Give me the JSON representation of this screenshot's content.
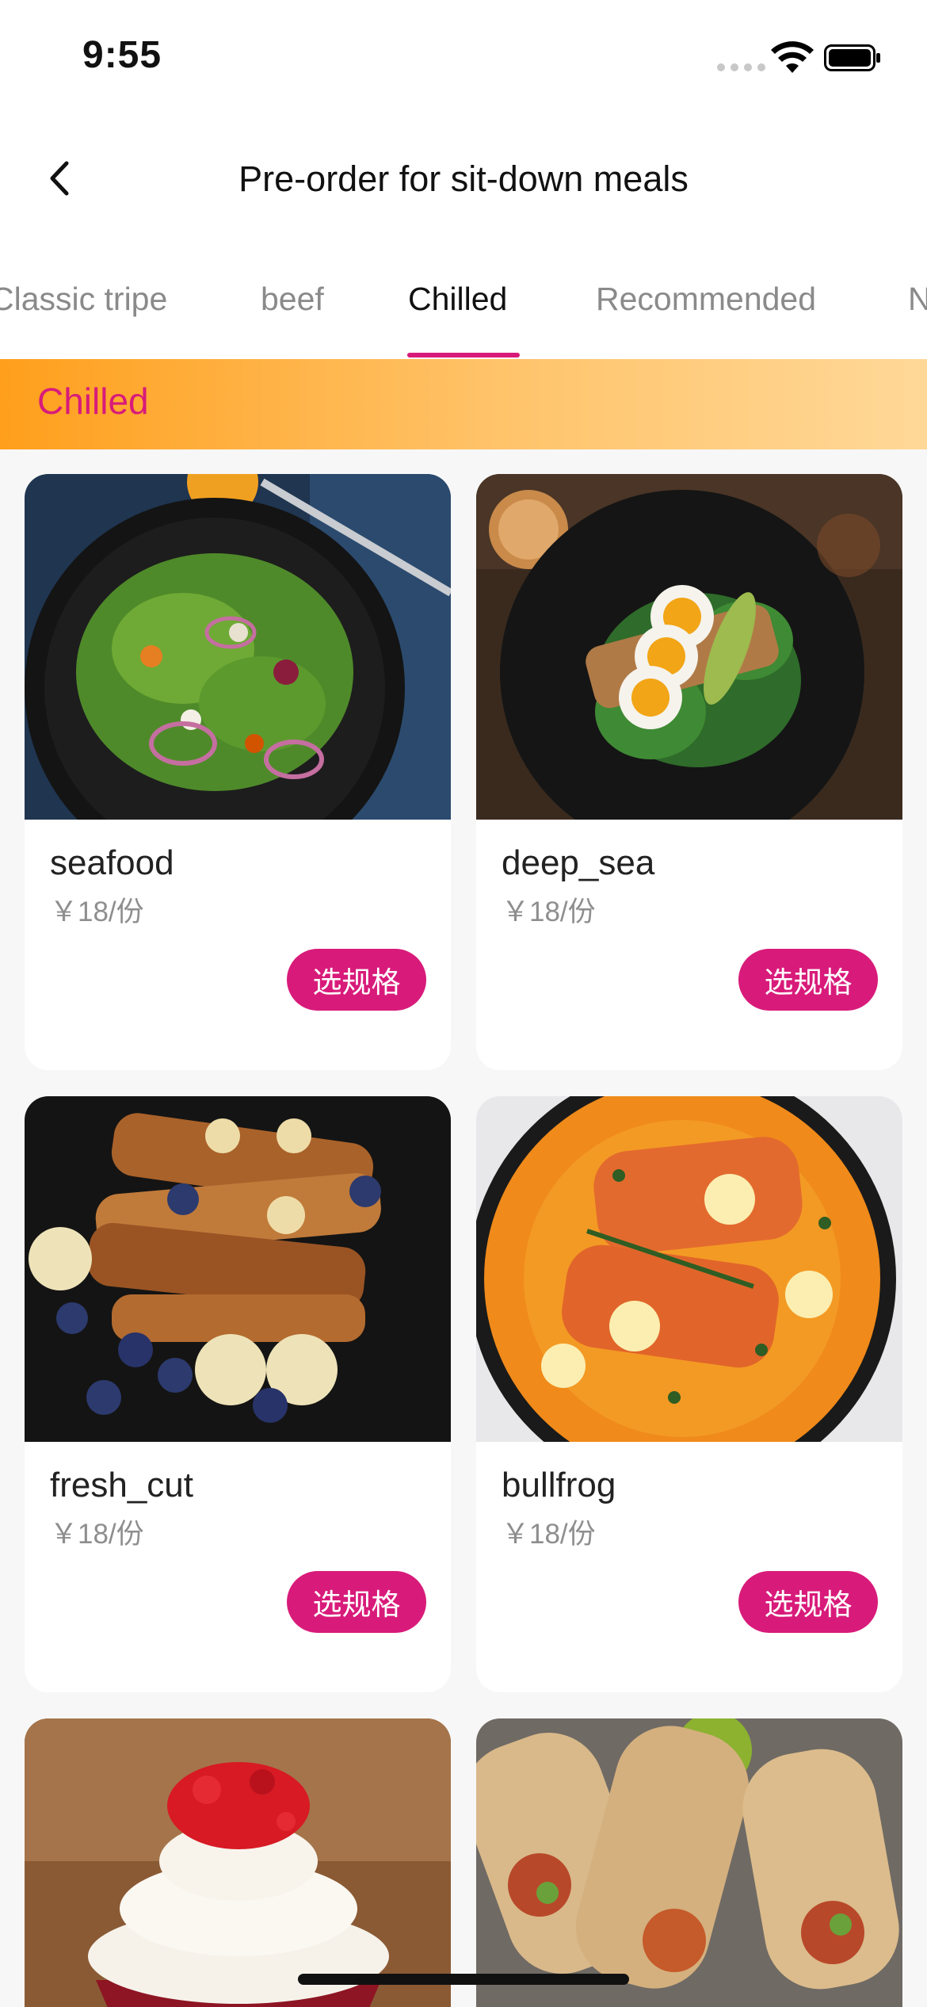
{
  "status_bar": {
    "time": "9:55"
  },
  "header": {
    "title": "Pre-order for sit-down meals"
  },
  "tabs": [
    {
      "label": "Classic tripe",
      "active": false
    },
    {
      "label": "beef",
      "active": false
    },
    {
      "label": "Chilled",
      "active": true
    },
    {
      "label": "Recommended",
      "active": false
    },
    {
      "label": "N",
      "active": false
    }
  ],
  "section": {
    "title": "Chilled"
  },
  "products": [
    {
      "name": "seafood",
      "price": "￥18/份",
      "button": "选规格"
    },
    {
      "name": "deep_sea",
      "price": "￥18/份",
      "button": "选规格"
    },
    {
      "name": "fresh_cut",
      "price": "￥18/份",
      "button": "选规格"
    },
    {
      "name": "bullfrog",
      "price": "￥18/份",
      "button": "选规格"
    }
  ],
  "colors": {
    "accent": "#d81b7a",
    "banner_start": "#ff9f1c",
    "banner_end": "#ffd898"
  }
}
